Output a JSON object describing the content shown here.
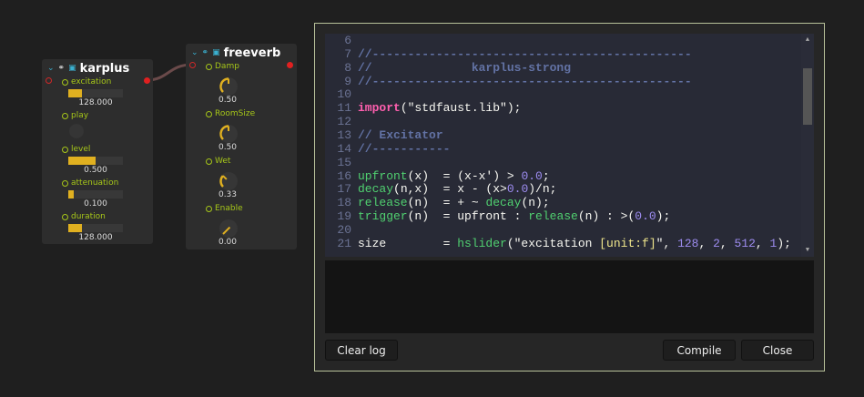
{
  "nodes": {
    "karplus": {
      "title": "karplus",
      "params": [
        {
          "label": "excitation",
          "type": "slider",
          "value": "128.000",
          "fraction": 0.25
        },
        {
          "label": "play",
          "type": "button"
        },
        {
          "label": "level",
          "type": "slider",
          "value": "0.500",
          "fraction": 0.5
        },
        {
          "label": "attenuation",
          "type": "slider",
          "value": "0.100",
          "fraction": 0.1
        },
        {
          "label": "duration",
          "type": "slider",
          "value": "128.000",
          "fraction": 0.25
        }
      ]
    },
    "freeverb": {
      "title": "freeverb",
      "params": [
        {
          "label": "Damp",
          "value": "0.50",
          "fraction": 0.5
        },
        {
          "label": "RoomSize",
          "value": "0.50",
          "fraction": 0.5
        },
        {
          "label": "Wet",
          "value": "0.33",
          "fraction": 0.33
        },
        {
          "label": "Enable",
          "value": "0.00",
          "fraction": 0.0
        }
      ]
    }
  },
  "colors": {
    "accent": "#a6c619",
    "slider": "#e0b020",
    "port": "#e02020"
  },
  "editor": {
    "lines": [
      {
        "n": "6",
        "t": []
      },
      {
        "n": "7",
        "t": [
          [
            "c",
            "//---------------------------------------------"
          ]
        ]
      },
      {
        "n": "8",
        "t": [
          [
            "c",
            "//              karplus-strong"
          ]
        ]
      },
      {
        "n": "9",
        "t": [
          [
            "c",
            "//---------------------------------------------"
          ]
        ]
      },
      {
        "n": "10",
        "t": []
      },
      {
        "n": "11",
        "t": [
          [
            "k",
            "import"
          ],
          [
            "",
            "(\"stdfaust.lib\");"
          ]
        ]
      },
      {
        "n": "12",
        "t": []
      },
      {
        "n": "13",
        "t": [
          [
            "c",
            "// Excitator"
          ]
        ]
      },
      {
        "n": "14",
        "t": [
          [
            "c",
            "//-----------"
          ]
        ]
      },
      {
        "n": "15",
        "t": []
      },
      {
        "n": "16",
        "t": [
          [
            "f",
            "upfront"
          ],
          [
            "",
            "(x)  = (x-x') > "
          ],
          [
            "n",
            "0.0"
          ],
          [
            "",
            ";"
          ]
        ]
      },
      {
        "n": "17",
        "t": [
          [
            "f",
            "decay"
          ],
          [
            "",
            "(n,x)  = x - (x>"
          ],
          [
            "n",
            "0.0"
          ],
          [
            "",
            ")/n;"
          ]
        ]
      },
      {
        "n": "18",
        "t": [
          [
            "f",
            "release"
          ],
          [
            "",
            "(n)  = + ~ "
          ],
          [
            "f",
            "decay"
          ],
          [
            "",
            "(n);"
          ]
        ]
      },
      {
        "n": "19",
        "t": [
          [
            "f",
            "trigger"
          ],
          [
            "",
            "(n)  = upfront : "
          ],
          [
            "f",
            "release"
          ],
          [
            "",
            "(n) : >("
          ],
          [
            "n",
            "0.0"
          ],
          [
            "",
            ");"
          ]
        ]
      },
      {
        "n": "20",
        "t": []
      },
      {
        "n": "21",
        "t": [
          [
            "",
            "size        = "
          ],
          [
            "f",
            "hslider"
          ],
          [
            "",
            "(\"excitation "
          ],
          [
            "s",
            "[unit:f]"
          ],
          [
            "",
            "\", "
          ],
          [
            "n",
            "128"
          ],
          [
            "",
            ", "
          ],
          [
            "n",
            "2"
          ],
          [
            "",
            ", "
          ],
          [
            "n",
            "512"
          ],
          [
            "",
            ", "
          ],
          [
            "n",
            "1"
          ],
          [
            "",
            ");"
          ]
        ]
      }
    ]
  },
  "buttons": {
    "clear_log": "Clear log",
    "compile": "Compile",
    "close": "Close"
  }
}
